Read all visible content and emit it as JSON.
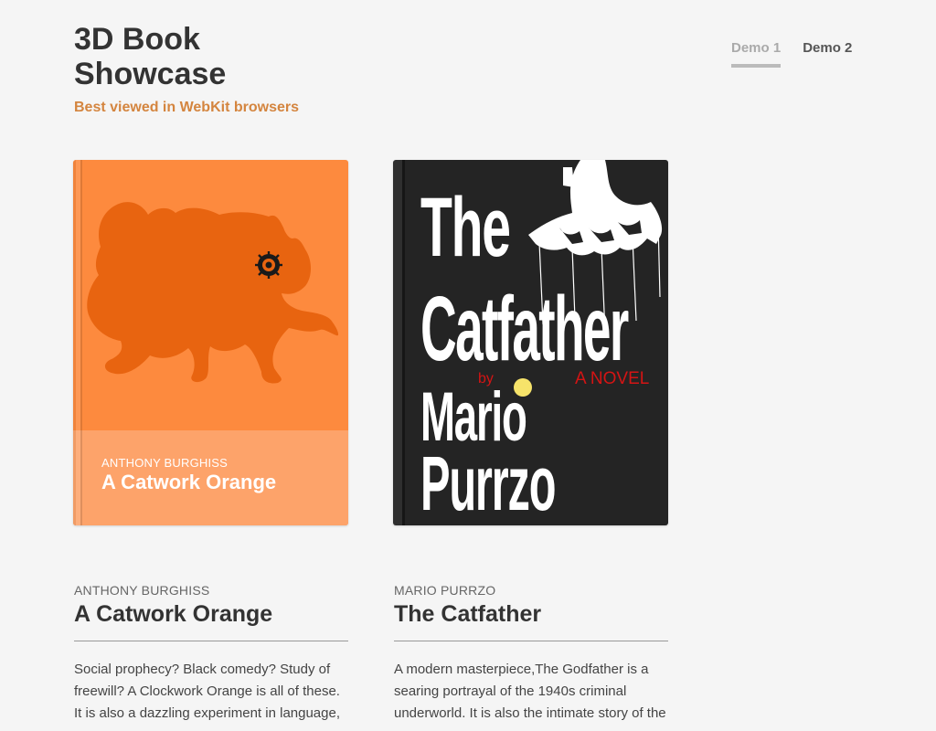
{
  "header": {
    "title": "3D Book Showcase",
    "subtitle": "Best viewed in WebKit browsers"
  },
  "nav": {
    "demo1": "Demo 1",
    "demo2": "Demo 2",
    "active": "Demo 1"
  },
  "books": [
    {
      "author": "ANTHONY BURGHISS",
      "title": "A Catwork Orange",
      "cover_color": "#fd8a3e",
      "cover_panel_color": "#fda36a",
      "description": "Social prophecy? Black comedy? Study of freewill? A Clockwork Orange is all of these. It is also a dazzling experiment in language,"
    },
    {
      "author": "MARIO PURRZO",
      "title": "The Catfather",
      "cover_color": "#242424",
      "cover_lines": {
        "the": "The",
        "catfather": "Catfather",
        "by": "by",
        "novel": "A NOVEL",
        "mario": "Mario",
        "purrzo": "Purrzo"
      },
      "description": "A modern masterpiece,The Godfather is a searing portrayal of the 1940s criminal underworld. It is also the intimate story of the"
    }
  ],
  "colors": {
    "background": "#f5f5f5",
    "accent": "#d4853f",
    "text": "#333333"
  }
}
